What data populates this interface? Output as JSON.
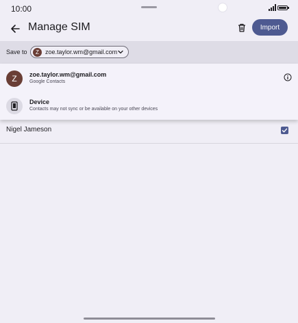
{
  "status_bar": {
    "time": "10:00"
  },
  "app_bar": {
    "title": "Manage SIM",
    "import_label": "Import"
  },
  "save_to": {
    "label": "Save to",
    "account_initial": "Z",
    "account_email": "zoe.taylor.wm@gmail.com"
  },
  "menu": {
    "items": [
      {
        "initial": "Z",
        "title": "zoe.taylor.wm@gmail.com",
        "subtitle": "Google Contacts",
        "icon": "account-avatar",
        "avatar_color": "#6a3e36"
      },
      {
        "title": "Device",
        "subtitle": "Contacts may not sync or be available on your other devices",
        "icon": "phone-icon",
        "avatar_color": "#dcdae4"
      }
    ]
  },
  "contacts": [
    {
      "name": "Nigel Jameson",
      "checked": true
    }
  ],
  "colors": {
    "accent": "#4e5a91",
    "background": "#f0eef6",
    "strip": "#dedce6"
  }
}
